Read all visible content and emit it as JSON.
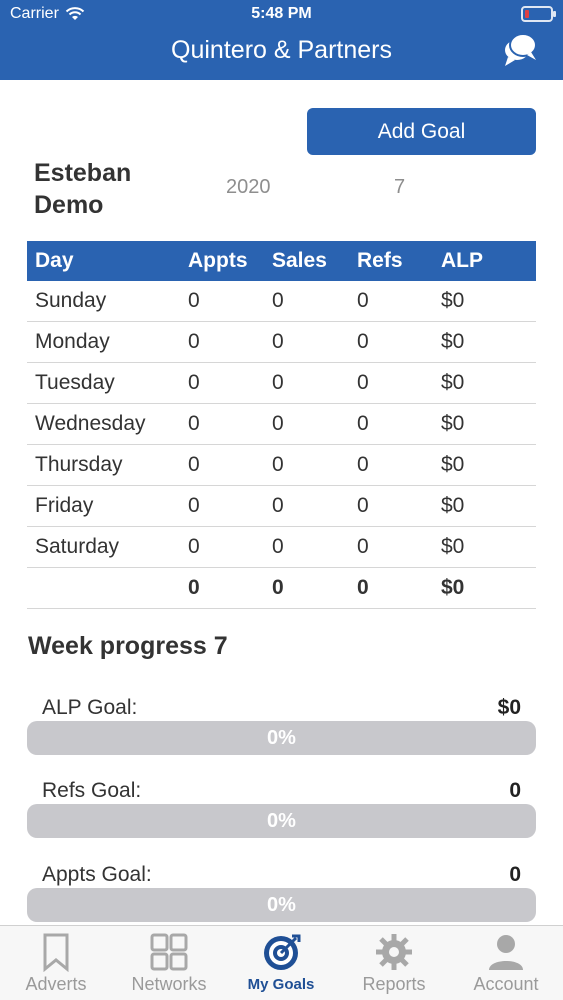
{
  "status_bar": {
    "carrier": "Carrier",
    "time": "5:48 PM"
  },
  "nav": {
    "title": "Quintero & Partners",
    "chat_icon": "chat-bubbles-icon"
  },
  "add_goal_label": "Add Goal",
  "user": {
    "name_line1": "Esteban",
    "name_line2": "Demo",
    "year": "2020",
    "week": "7"
  },
  "table": {
    "headers": [
      "Day",
      "Appts",
      "Sales",
      "Refs",
      "ALP"
    ],
    "rows": [
      [
        "Sunday",
        "0",
        "0",
        "0",
        "$0"
      ],
      [
        "Monday",
        "0",
        "0",
        "0",
        "$0"
      ],
      [
        "Tuesday",
        "0",
        "0",
        "0",
        "$0"
      ],
      [
        "Wednesday",
        "0",
        "0",
        "0",
        "$0"
      ],
      [
        "Thursday",
        "0",
        "0",
        "0",
        "$0"
      ],
      [
        "Friday",
        "0",
        "0",
        "0",
        "$0"
      ],
      [
        "Saturday",
        "0",
        "0",
        "0",
        "$0"
      ]
    ],
    "totals": [
      "",
      "0",
      "0",
      "0",
      "$0"
    ]
  },
  "week_progress_title": "Week progress 7",
  "goals": [
    {
      "label": "ALP Goal:",
      "value": "$0",
      "percent_text": "0%",
      "progress": 0
    },
    {
      "label": "Refs Goal:",
      "value": "0",
      "percent_text": "0%",
      "progress": 0
    },
    {
      "label": "Appts Goal:",
      "value": "0",
      "percent_text": "0%",
      "progress": 0
    }
  ],
  "tabs": [
    {
      "label": "Adverts",
      "icon": "bookmark-icon",
      "active": false
    },
    {
      "label": "Networks",
      "icon": "grid-icon",
      "active": false
    },
    {
      "label": "My Goals",
      "icon": "target-icon",
      "active": true
    },
    {
      "label": "Reports",
      "icon": "gear-icon",
      "active": false
    },
    {
      "label": "Account",
      "icon": "person-icon",
      "active": false
    }
  ],
  "colors": {
    "brand": "#2a63b1",
    "tab_active": "#1f4f95",
    "tab_inactive": "#9a9a9a",
    "bar_track": "#c8c8cc"
  }
}
